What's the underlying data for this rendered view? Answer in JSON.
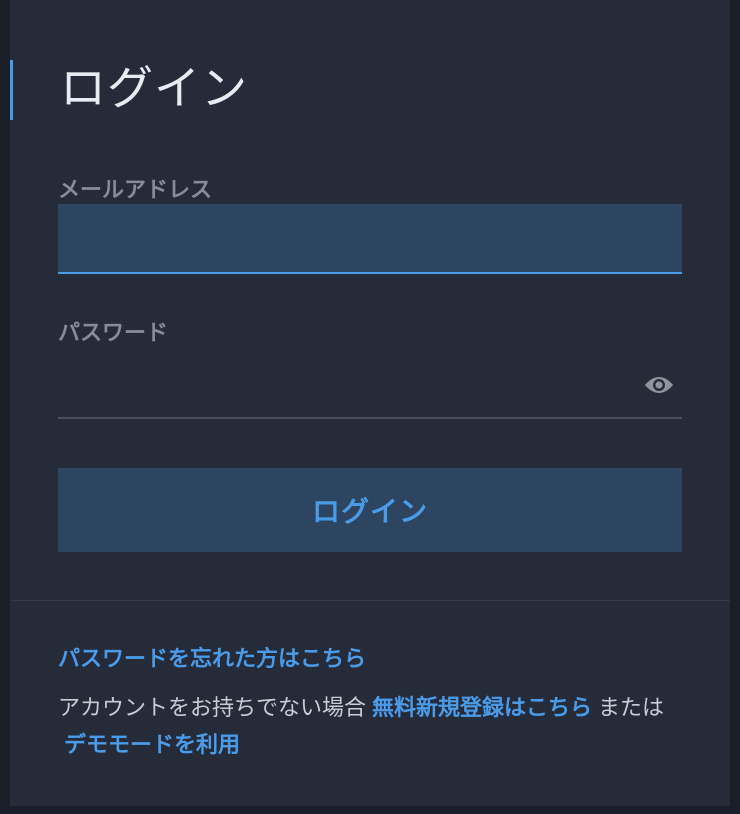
{
  "login": {
    "title": "ログイン",
    "email_label": "メールアドレス",
    "email_value": "",
    "password_label": "パスワード",
    "password_value": "",
    "submit_label": "ログイン"
  },
  "footer": {
    "forgot_password": "パスワードを忘れた方はこちら",
    "no_account_prefix": "アカウントをお持ちでない場合",
    "signup_link": "無料新規登録はこちら",
    "or_text": "または",
    "demo_link": "デモモードを利用"
  },
  "colors": {
    "accent": "#4a9be8",
    "background": "#262b3a",
    "input_fill": "#2d4560",
    "label": "#868c98"
  },
  "icons": {
    "password_toggle": "eye-icon"
  }
}
